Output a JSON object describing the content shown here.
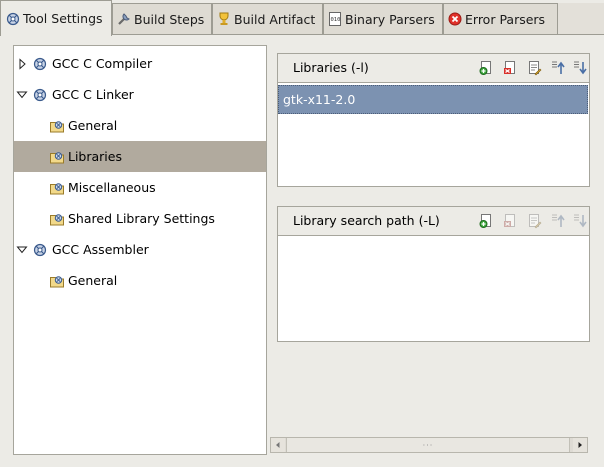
{
  "tabs": [
    {
      "label": "Tool Settings",
      "icon": "tool-settings-icon",
      "active": true
    },
    {
      "label": "Build Steps",
      "icon": "build-steps-icon",
      "active": false
    },
    {
      "label": "Build Artifact",
      "icon": "build-artifact-icon",
      "active": false
    },
    {
      "label": "Binary Parsers",
      "icon": "binary-parsers-icon",
      "active": false
    },
    {
      "label": "Error Parsers",
      "icon": "error-parsers-icon",
      "active": false
    }
  ],
  "tree": [
    {
      "label": "GCC C Compiler",
      "type": "tool",
      "expanded": false
    },
    {
      "label": "GCC C Linker",
      "type": "tool",
      "expanded": true
    },
    {
      "label": "General",
      "type": "option-category"
    },
    {
      "label": "Libraries",
      "type": "option-category",
      "selected": true
    },
    {
      "label": "Miscellaneous",
      "type": "option-category"
    },
    {
      "label": "Shared Library Settings",
      "type": "option-category"
    },
    {
      "label": "GCC Assembler",
      "type": "tool",
      "expanded": true
    },
    {
      "label": "General",
      "type": "option-category"
    }
  ],
  "libraries": {
    "title": "Libraries (-l)",
    "items": [
      "gtk-x11-2.0"
    ]
  },
  "library_search_path": {
    "title": "Library search path (-L)",
    "items": []
  },
  "scrollbar": {
    "grip": "···"
  },
  "colors": {
    "selection_tree": "#b1aa9e",
    "selection_list": "#7c92b1",
    "window_bg": "#ecebe6"
  }
}
